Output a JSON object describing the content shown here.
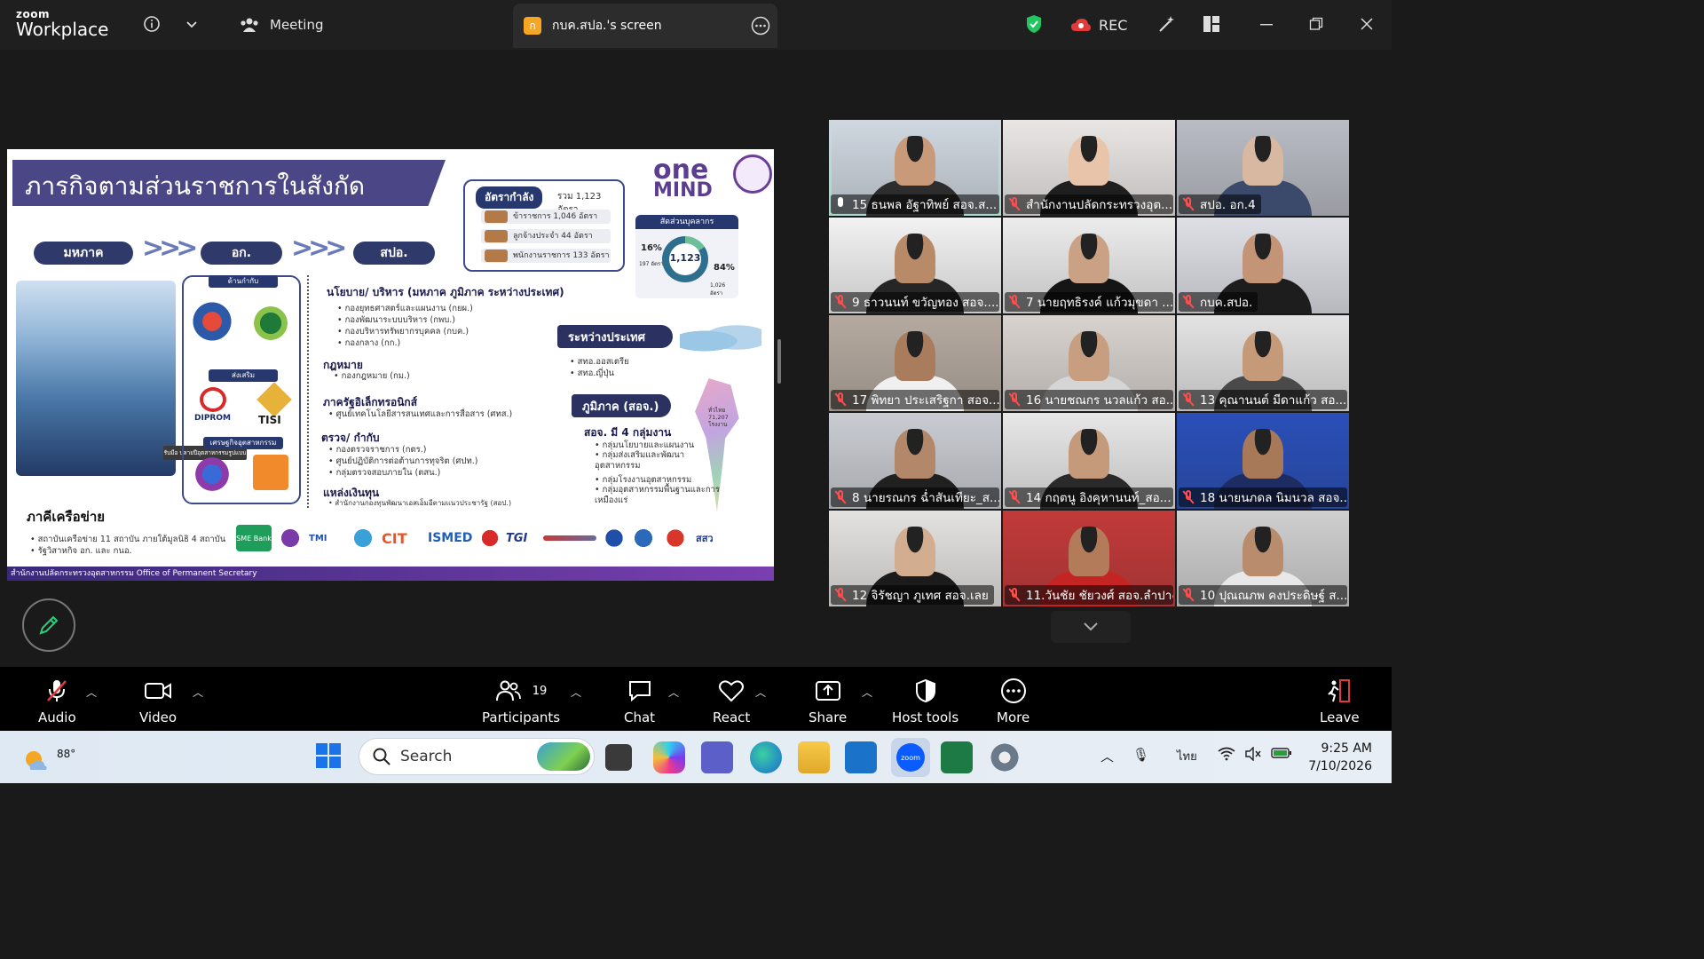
{
  "app": {
    "brand_small": "zoom",
    "brand_big": "Workplace",
    "meeting_label": "Meeting",
    "screen_tab_badge": "ก",
    "screen_tab_label": "กบค.สปอ.'s screen",
    "rec_label": "REC"
  },
  "slide": {
    "title": "ภารกิจตามส่วนราชการในสังกัด",
    "chain": [
      "มหภาค",
      "อก.",
      "สปอ."
    ],
    "rate": {
      "head": "อัตรากำลัง",
      "total": "รวม 1,123 อัตรา",
      "rows": [
        "ข้าราชการ 1,046 อัตรา",
        "ลูกจ้างประจำ 44 อัตรา",
        "พนักงานราชการ 133 อัตรา"
      ]
    },
    "logo_one": "one",
    "logo_mind": "MIND",
    "ratio": {
      "head": "สัดส่วนบุคลากร",
      "left_pct": "16%",
      "left_sub": "197 อัตรา",
      "center": "1,123",
      "right_pct": "84%",
      "right_sub": "1,026 อัตรา"
    },
    "sidebox_labels": [
      "ด้านกำกับ",
      "ส่งเสริม",
      "เศรษฐกิจอุตสาหกรรม"
    ],
    "sidebox_logos": [
      "DIPROM",
      "TISI"
    ],
    "caption": "รับมือ ปลายปีอุตสาหกรรมรูปแบบ",
    "sections": [
      {
        "head": "นโยบาย/ บริหาร (มหภาค ภูมิภาค ระหว่างประเทศ)",
        "items": [
          "กองยุทธศาสตร์และแผนงาน (กยผ.)",
          "กองพัฒนาระบบบริหาร (กพบ.)",
          "กองบริหารทรัพยากรบุคคล (กบค.)",
          "กองกลาง (กก.)"
        ]
      },
      {
        "head": "กฎหมาย",
        "items": [
          "กองกฎหมาย (กม.)"
        ]
      },
      {
        "head": "ภาครัฐอิเล็กทรอนิกส์",
        "items": [
          "ศูนย์เทคโนโลยีสารสนเทศและการสื่อสาร (ศทส.)"
        ]
      },
      {
        "head": "ตรวจ/ กำกับ",
        "items": [
          "กองตรวจราชการ (กตร.)",
          "ศูนย์ปฏิบัติการต่อต้านการทุจริต (ศปท.)",
          "กลุ่มตรวจสอบภายใน (ตสน.)"
        ]
      },
      {
        "head": "แหล่งเงินทุน",
        "items": [
          "สำนักงานกองทุนพัฒนาเอสเอ็มอีตามแนวประชารัฐ (สอป.)"
        ]
      }
    ],
    "intl_head": "ระหว่างประเทศ",
    "intl_items": [
      "สทอ.ออสเตรีย",
      "สทอ.ญี่ปุ่น"
    ],
    "region_head": "ภูมิภาค (สอจ.)",
    "region_sub": "สอจ. มี 4 กลุ่มงาน",
    "region_items": [
      "กลุ่มนโยบายและแผนงาน",
      "กลุ่มส่งเสริมและพัฒนา อุตสาหกรรม",
      "กลุ่มโรงงานอุตสาหกรรม",
      "กลุ่มอุตสาหกรรมพื้นฐานและการ เหมืองแร่"
    ],
    "factories": "ทั่วไทย 71,207 โรงงาน",
    "network_head": "ภาคีเครือข่าย",
    "network_items": [
      "สถาบันเครือข่าย 11 สถาบัน ภายใต้มูลนิธิ 4 สถาบัน",
      "รัฐวิสาหกิจ อก. และ กนอ."
    ],
    "network_logos": [
      "SME Bank",
      "TMI",
      "CIT",
      "ISMED",
      "TGI",
      "สสว"
    ],
    "footer": "สำนักงานปลัดกระทรวงอุตสาหกรรม Office of Permanent Secretary"
  },
  "participants_tiles": [
    {
      "name": "15 ธนพล อัฐาทิพย์ สอจ.ส...",
      "muted": false,
      "active": true,
      "tone": "#cfd7e0",
      "skin": "#c89a7a",
      "shirt": "#2d2d2d"
    },
    {
      "name": "สำนักงานปลัดกระทรวงอุต...",
      "muted": true,
      "tone": "#e9e6e4",
      "skin": "#e8c4aa",
      "shirt": "#1f1f1f"
    },
    {
      "name": "สปอ. อก.4",
      "muted": true,
      "tone": "#b9bcc4",
      "skin": "#d8b8a0",
      "shirt": "#3b4a6a"
    },
    {
      "name": "9 ธาวนนท์ ขวัญทอง สอจ....",
      "muted": true,
      "tone": "#f2f2f2",
      "skin": "#b88a68",
      "shirt": "#262626"
    },
    {
      "name": "7 นายฤทธิรงค์ แก้วมุขดา ...",
      "muted": true,
      "tone": "#ececec",
      "skin": "#caa184",
      "shirt": "#151515"
    },
    {
      "name": "กบค.สปอ.",
      "muted": true,
      "tone": "#dfe0e6",
      "skin": "#c49476",
      "shirt": "#1d1d1d"
    },
    {
      "name": "17 พิทยา ประเสริฐกา สอจ....",
      "muted": true,
      "tone": "#b5aaa0",
      "skin": "#a97c5e",
      "shirt": "#f0f0f0"
    },
    {
      "name": "16 นายชณกร นวลแก้ว สอ...",
      "muted": true,
      "tone": "#d9d3cf",
      "skin": "#c79e80",
      "shirt": "#d5d5d5"
    },
    {
      "name": "13 คุณานนต์ มีดาแก้ว สอ...",
      "muted": true,
      "tone": "#e3e3e3",
      "skin": "#c59a78",
      "shirt": "#4a4a4a"
    },
    {
      "name": "8 นายรณกร ฉ่ำสันเทียะ_ส...",
      "muted": true,
      "tone": "#c9ccd2",
      "skin": "#b2876a",
      "shirt": "#202020"
    },
    {
      "name": "14 กฤตนู อิงคุหานนท์_สอ...",
      "muted": true,
      "tone": "#e7e7e7",
      "skin": "#c49a7a",
      "shirt": "#2a2a2a"
    },
    {
      "name": "18 นายนภดล นิมนวล สอจ...",
      "muted": true,
      "tone": "#2a4fb8",
      "skin": "#a87958",
      "shirt": "#1d2d63"
    },
    {
      "name": "12 จิรัชญา ภูเทศ สอจ.เลย",
      "muted": true,
      "tone": "#e4e2e0",
      "skin": "#d2ad90",
      "shirt": "#1b1b1b"
    },
    {
      "name": "11.วันชัย ชัยวงศ์ สอจ.ลำปาง",
      "muted": true,
      "tone": "#c23a3a",
      "skin": "#b37b5a",
      "shirt": "#c42424"
    },
    {
      "name": "10 ปุณณภพ คงประดิษฐ์ ส...",
      "muted": true,
      "tone": "#cfcfcf",
      "skin": "#b88c6c",
      "shirt": "#e8e8e8"
    }
  ],
  "controls": {
    "audio": "Audio",
    "video": "Video",
    "participants": "Participants",
    "participants_count": "19",
    "chat": "Chat",
    "react": "React",
    "share": "Share",
    "host_tools": "Host tools",
    "more": "More",
    "leave": "Leave"
  },
  "taskbar": {
    "temp": "88°",
    "search": "Search",
    "lang": "ไทย",
    "time": "9:25 AM",
    "date": "7/10/2026"
  },
  "colors": {
    "accent_green": "#22d37a",
    "slide_purple": "#4b4685",
    "rec_red": "#e03a3a"
  }
}
